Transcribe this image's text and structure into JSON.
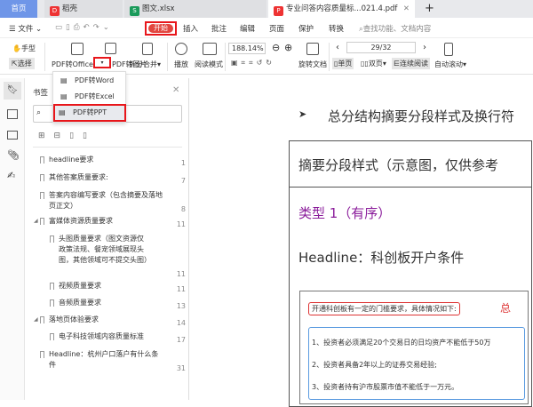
{
  "tabs": [
    {
      "label": "首页"
    },
    {
      "label": "稻壳"
    },
    {
      "label": "图文.xlsx"
    },
    {
      "label": "专业问答内容质量标...021.4.pdf"
    }
  ],
  "menu": {
    "file": "文件",
    "items": [
      "开始",
      "插入",
      "批注",
      "编辑",
      "页面",
      "保护",
      "转换"
    ],
    "search_placeholder": "查找功能、文档内容"
  },
  "toolbar": {
    "hand": "手型",
    "select": "选择",
    "pdf_to_office": "PDF转Office",
    "pdf_to_image": "PDF转图片",
    "split_merge": "拆分合并",
    "play": "播放",
    "read_mode": "阅读模式",
    "zoom": "188.14%",
    "rotate": "旋转文档",
    "page": "29/32",
    "single": "单页",
    "double": "双页",
    "continuous": "连续阅读",
    "auto_scroll": "自动滚动"
  },
  "dropdown": [
    "PDF转Word",
    "PDF转Excel",
    "PDF转PPT"
  ],
  "bookmarks": {
    "title": "书签",
    "items": [
      {
        "label": "headline要求",
        "page": "1"
      },
      {
        "label": "其他答案质量要求:",
        "page": "7"
      },
      {
        "label": "答案内容编写要求（包含摘要及落地页正文）",
        "page": "8"
      },
      {
        "label": "富媒体资源质量要求",
        "page": "11"
      },
      {
        "label": "头图质量要求（图文资源仅政策法规、餐宠领域展现头图，其他领域可不提交头图）",
        "page": "11"
      },
      {
        "label": "视频质量要求",
        "page": "11"
      },
      {
        "label": "音频质量要求",
        "page": "13"
      },
      {
        "label": "落地页体验要求",
        "page": "14"
      },
      {
        "label": "电子科技领域内容质量标准",
        "page": "17"
      },
      {
        "label": "Headline：杭州户口落户有什么条件",
        "page": "31"
      }
    ]
  },
  "doc": {
    "heading": "总分结构摘要分段样式及换行符",
    "box_title": "摘要分段样式（示意图，仅供参考",
    "type_label": "类型 1（有序）",
    "headline": "Headline：科创板开户条件",
    "intro": "开通科创板有一定的门槛要求，具体情况如下:",
    "zong": "总",
    "items": [
      "1、投资者必须满足20个交易日的日均资产不能低于50万",
      "2、投资者具备2年以上的证券交易经验;",
      "3、投资者持有沪市股票市值不能低于一万元。"
    ]
  },
  "colors": {
    "accent": "#e2463f",
    "highlight_red": "#e8161b",
    "purple": "#8b1d9b",
    "blue_box": "#5b9be0"
  }
}
